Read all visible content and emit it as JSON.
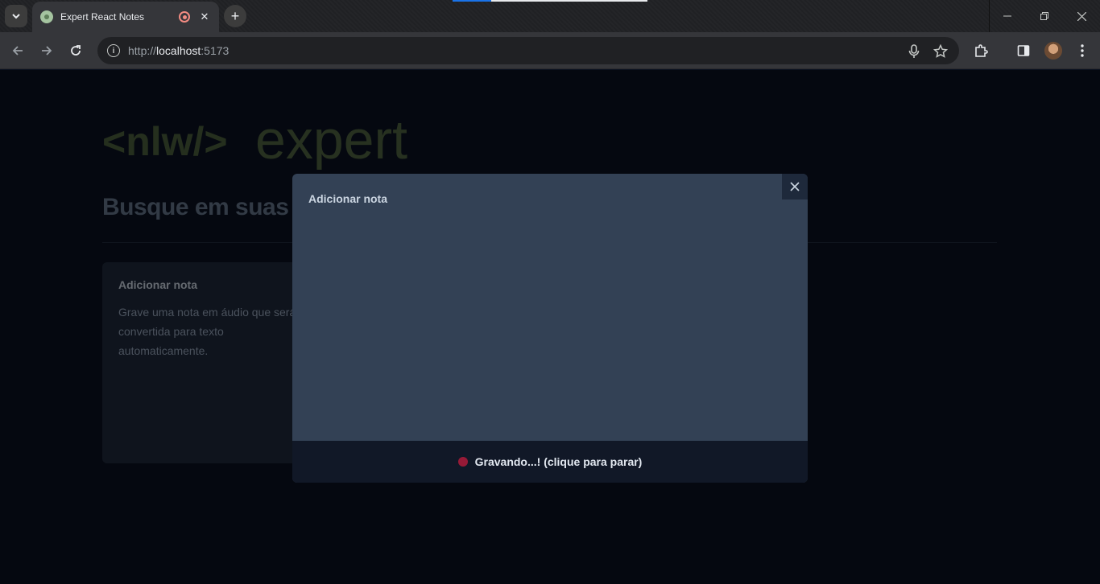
{
  "browser": {
    "tab_title": "Expert React Notes",
    "url_scheme": "http://",
    "url_host": "localhost",
    "url_port": ":5173"
  },
  "page": {
    "logo_left": "<nlw/>",
    "logo_right": "expert",
    "search_text": "Busque em suas notas...",
    "add_card": {
      "title": "Adicionar nota",
      "description": "Grave uma nota em áudio que será convertida para texto automaticamente."
    }
  },
  "modal": {
    "title": "Adicionar nota",
    "recording_label": "Gravando...! (clique para parar)"
  },
  "colors": {
    "logo_green": "#4b5e3c",
    "logo_text": "#556b47",
    "recording_dot": "#b91c3c",
    "modal_bg": "#334155",
    "page_bg": "#0b1120"
  }
}
